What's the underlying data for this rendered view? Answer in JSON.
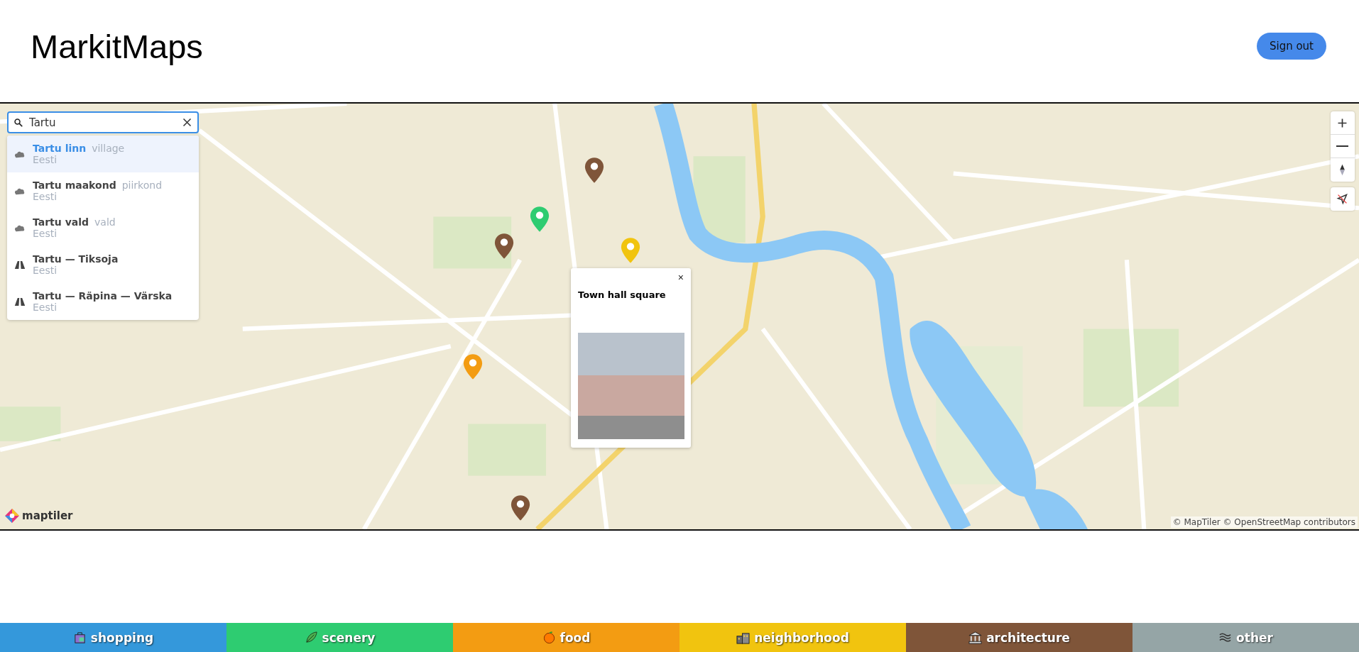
{
  "header": {
    "logo": "MarkitMaps",
    "sign_out": "Sign out"
  },
  "search": {
    "value": "Tartu",
    "results": [
      {
        "name": "Tartu linn",
        "type": "village",
        "country": "Eesti",
        "kind": "area",
        "selected": true
      },
      {
        "name": "Tartu maakond",
        "type": "piirkond",
        "country": "Eesti",
        "kind": "area",
        "selected": false
      },
      {
        "name": "Tartu vald",
        "type": "vald",
        "country": "Eesti",
        "kind": "area",
        "selected": false
      },
      {
        "name": "Tartu — Tiksoja",
        "country": "Eesti",
        "kind": "road",
        "selected": false
      },
      {
        "name": "Tartu — Räpina — Värska",
        "country": "Eesti",
        "kind": "road",
        "selected": false
      }
    ]
  },
  "map": {
    "markers": [
      {
        "color": "#7f5539"
      },
      {
        "color": "#2ecc71"
      },
      {
        "color": "#7f5539"
      },
      {
        "color": "#f1c40f"
      },
      {
        "color": "#f39c12"
      },
      {
        "color": "#7f5539"
      }
    ],
    "popup": {
      "title": "Town hall square",
      "close": "×"
    },
    "logo": "maptiler",
    "attribution": "© MapTiler © OpenStreetMap contributors"
  },
  "categories": [
    {
      "label": "shopping",
      "color": "#3498db",
      "kind": "bag"
    },
    {
      "label": "scenery",
      "color": "#2ecc71",
      "kind": "leaf"
    },
    {
      "label": "food",
      "color": "#f39c12",
      "kind": "fruit"
    },
    {
      "label": "neighborhood",
      "color": "#f1c40f",
      "kind": "houses"
    },
    {
      "label": "architecture",
      "color": "#7f5539",
      "kind": "building"
    },
    {
      "label": "other",
      "color": "#95a5a6",
      "kind": "waves"
    }
  ]
}
